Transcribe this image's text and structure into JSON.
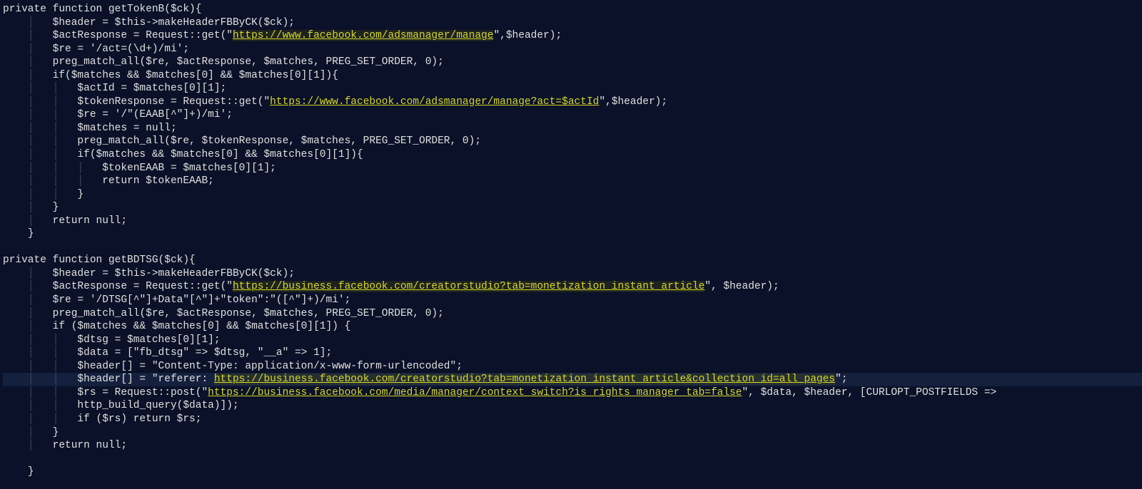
{
  "colors": {
    "bg": "#0a1128",
    "fg": "#dddddd",
    "highlight": "#d6d62a"
  },
  "f1": {
    "sig": "private function getTokenB($ck){",
    "l1": "$header = $this->makeHeaderFBByCK($ck);",
    "l2a": "$actResponse = Request::get(",
    "l2q1": "\"",
    "l2url": "https://www.facebook.com/adsmanager/manage",
    "l2q2": "\"",
    "l2b": ",$header);",
    "l3": "$re = '/act=(\\d+)/mi';",
    "l4": "preg_match_all($re, $actResponse, $matches, PREG_SET_ORDER, 0);",
    "l5": "if($matches && $matches[0] && $matches[0][1]){",
    "l6": "$actId = $matches[0][1];",
    "l7a": "$tokenResponse = Request::get(\"",
    "l7url": "https://www.facebook.com/adsmanager/manage?act=$actId",
    "l7b": "\",$header);",
    "l8": "$re = '/\"(EAAB[^\"]+)/mi';",
    "l9": "$matches = null;",
    "l10": "preg_match_all($re, $tokenResponse, $matches, PREG_SET_ORDER, 0);",
    "l11": "if($matches && $matches[0] && $matches[0][1]){",
    "l12": "$tokenEAAB = $matches[0][1];",
    "l13": "return $tokenEAAB;",
    "l14": "}",
    "l15": "}",
    "l16": "return null;",
    "l17": "}"
  },
  "f2": {
    "sig": "private function getBDTSG($ck){",
    "l1": "$header = $this->makeHeaderFBByCK($ck);",
    "l2a": "$actResponse = Request::get(\"",
    "l2url": "https://business.facebook.com/creatorstudio?tab=monetization_instant_article",
    "l2b": "\", $header);",
    "l3": "$re = '/DTSG[^\"]+Data\"[^\"]+\"token\":\"([^\"]+)/mi';",
    "l4": "preg_match_all($re, $actResponse, $matches, PREG_SET_ORDER, 0);",
    "l5": "if ($matches && $matches[0] && $matches[0][1]) {",
    "l6": "$dtsg = $matches[0][1];",
    "l7": "$data = [\"fb_dtsg\" => $dtsg, \"__a\" => 1];",
    "l8": "$header[] = \"Content-Type: application/x-www-form-urlencoded\";",
    "l9a": "$header[] = \"referer: ",
    "l9url": "https://business.facebook.com/creatorstudio",
    "l9b": "?tab=monetization_instant_article&collection_id=all_pages",
    "l9c": "\";",
    "l10a": "$rs = Request::post(\"",
    "l10url": "https://business.facebook.com/media/manager/context_switch?is_rights_manager_tab=false",
    "l10b": "\", $data, $header, [CURLOPT_POSTFIELDS =>",
    "l11": "http_build_query($data)]);",
    "l12": "if ($rs) return $rs;",
    "l13": "}",
    "l14": "return null;",
    "l15": "}"
  },
  "guides": {
    "g0": "",
    "g1": "    ",
    "g2": "    │   ",
    "g3": "    │   │   ",
    "g4": "    │   │   │   "
  }
}
